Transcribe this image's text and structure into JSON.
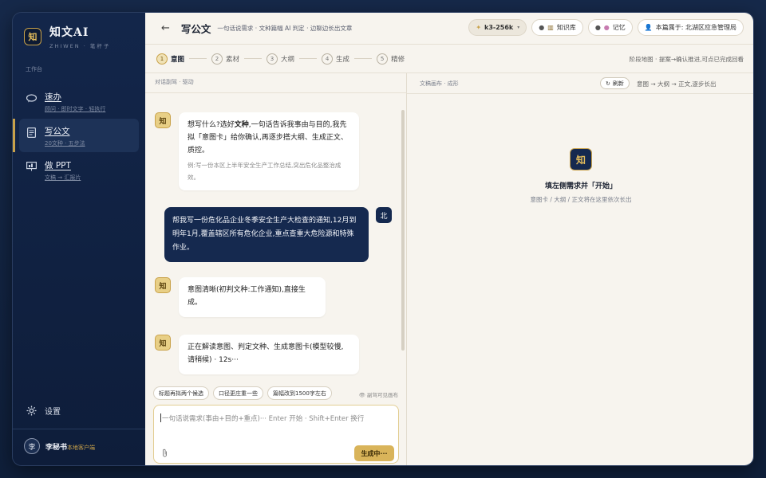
{
  "app": {
    "logo_glyph": "知",
    "title": "知文AI",
    "subtitle": "ZHIWEN · 笔杆子"
  },
  "sidebar": {
    "section_label": "工作台",
    "items": [
      {
        "title": "速办",
        "sub": "顾问 · 即时文字 · 轻执行",
        "icon": "chat-bubble-icon"
      },
      {
        "title": "写公文",
        "sub": "20文种 · 五步法",
        "icon": "document-icon"
      },
      {
        "title": "做 PPT",
        "sub": "文稿 → 汇报片",
        "icon": "slides-icon"
      }
    ],
    "settings_label": "设置",
    "user": {
      "avatar": "李",
      "name": "李秘书",
      "tag": "本地客户端"
    }
  },
  "header": {
    "back": "←",
    "title": "写公文",
    "desc": "一句话说需求 · 文种篇幅 AI 判定 · 边聊边长出文章",
    "model_chip": "k3-256k",
    "knowledge_chip": "知识库",
    "memory_chip": "记忆",
    "owner_chip": "本篇属于: 北湖区应急管理局"
  },
  "stepper": {
    "steps": [
      {
        "num": "1",
        "label": "意图"
      },
      {
        "num": "2",
        "label": "素材"
      },
      {
        "num": "3",
        "label": "大纲"
      },
      {
        "num": "4",
        "label": "生成"
      },
      {
        "num": "5",
        "label": "精修"
      }
    ],
    "hint": "阶段地图 · 提案→确认推进,可点已完成回看"
  },
  "chat": {
    "caption": "对话副驾 · 驱动",
    "bot_avatar": "知",
    "user_avatar": "北",
    "msg1_prefix": "想写什么?选好",
    "msg1_bold": "文种",
    "msg1_rest": ",一句话告诉我事由与目的,我先拟「意图卡」给你确认,再逐步搭大纲、生成正文、质控。",
    "msg1_example": "例:写一份本区上半年安全生产工作总结,突出危化品整治成效。",
    "msg2": "帮我写一份危化品企业冬季安全生产大检查的通知,12月到明年1月,覆盖辖区所有危化企业,重点查重大危险源和特殊作业。",
    "msg3": "意图清晰(初判文种:工作通知),直接生成。",
    "msg4": "正在解读意图、判定文种、生成意图卡(模型较慢,请稍候) · 12s···",
    "suggestions": [
      "标题再拟两个候选",
      "口径更庄重一些",
      "篇幅改到1500字左右"
    ],
    "suggest_hint": "副驾可见画布",
    "input_placeholder": "一句话说需求(事由+目的+重点)··· Enter 开始 · Shift+Enter 换行",
    "generate_label": "生成中···"
  },
  "canvas": {
    "caption": "文稿画布 · 成形",
    "refresh_label": "刷新",
    "flow": "意图 → 大纲 → 正文,逐步长出",
    "empty_logo": "知",
    "empty_title": "填左侧需求并「开始」",
    "empty_sub": "意图卡 / 大纲 / 正文将在这里依次长出"
  }
}
